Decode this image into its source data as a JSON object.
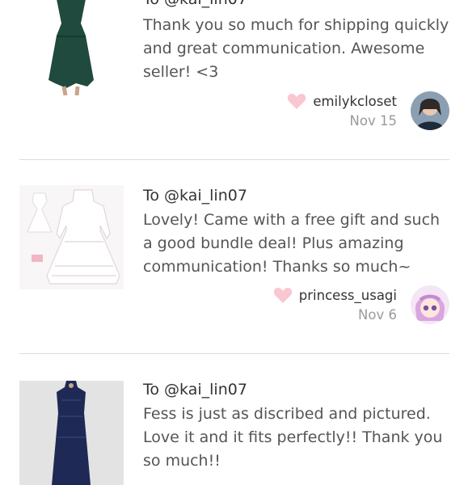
{
  "reviews": [
    {
      "to": "To @kai_lin07",
      "text": "Thank you so much for shipping quickly and great communication. Awesome seller! <3",
      "username": "emilykcloset",
      "date": "Nov 15",
      "colors": {
        "thumb_bg": "#ffffff",
        "item": "#1f4a3d",
        "avatar_bg": "#3a5568"
      }
    },
    {
      "to": "To @kai_lin07",
      "text": "Lovely! Came with a free gift and such a good bundle deal! Plus amazing communication! Thanks so much~",
      "username": "princess_usagi",
      "date": "Nov 6",
      "colors": {
        "thumb_bg": "#f8f6f6",
        "item": "#ffffff",
        "avatar_bg": "#e9b8e6"
      }
    },
    {
      "to": "To @kai_lin07",
      "text": "Fess is just as discribed and pictured. Love it and it fits perfectly!! Thank you so much!!",
      "colors": {
        "thumb_bg": "#e3e3e3",
        "item": "#1e2a55"
      }
    }
  ],
  "colors": {
    "heart": "#f9c7d0",
    "divider": "#dcdcdc",
    "date": "#9a9a9a"
  }
}
